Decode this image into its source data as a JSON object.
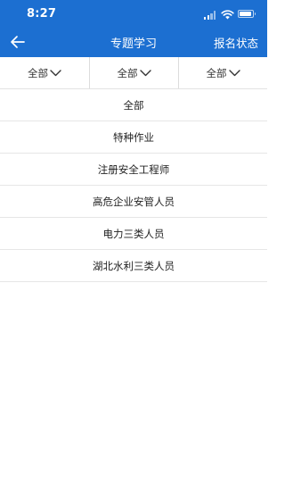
{
  "status_bar": {
    "time": "8:27"
  },
  "nav": {
    "title": "专题学习",
    "right_action": "报名状态",
    "back_icon": "arrow-left-icon"
  },
  "filters": [
    {
      "label": "全部",
      "icon": "chevron-down-icon"
    },
    {
      "label": "全部",
      "icon": "chevron-down-icon"
    },
    {
      "label": "全部",
      "icon": "chevron-down-icon"
    }
  ],
  "categories": [
    {
      "label": "全部"
    },
    {
      "label": "特种作业"
    },
    {
      "label": "注册安全工程师"
    },
    {
      "label": "高危企业安管人员"
    },
    {
      "label": "电力三类人员"
    },
    {
      "label": "湖北水利三类人员"
    }
  ],
  "colors": {
    "header_bg": "#1c6fd1",
    "header_text": "#ffffff",
    "list_text": "#222222",
    "divider": "#e6e6e6"
  }
}
